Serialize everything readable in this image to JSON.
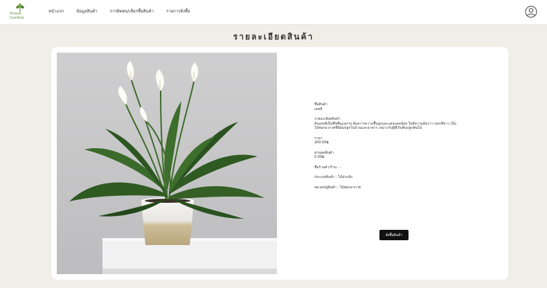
{
  "brand": {
    "line1": "Prana",
    "line2": "Garden"
  },
  "nav": {
    "items": [
      {
        "label": "หน้าแรก"
      },
      {
        "label": "ข้อมูลสินค้า"
      },
      {
        "label": "การติดต่อ/เลือกซื้อสินค้า"
      },
      {
        "label": "รายการสั่งซื้อ"
      }
    ]
  },
  "page": {
    "title": "รายละเอียดสินค้า"
  },
  "product": {
    "name_label": "ชื่อสินค้า",
    "name": "เดหลี",
    "desc_label": "รายละเอียดสินค้า",
    "desc": "ต้นเดหลีเป็นพืชที่ดูแลง่าย ต้องการความชื้นสูงและแสงแดดน้อย ใบมีความมันวาว ดอกสีขาว เป็นไม้ฟอกอากาศที่นิยมปลูกในบ้านและอาคาร เหมาะกับผู้ที่เริ่มต้นปลูกต้นไม้",
    "price_label": "ราคา",
    "price": "200.00฿",
    "discount_label": "ส่วนลดสินค้า",
    "discount": "0.00฿",
    "seller_label": "ชื่อร้านค้า/ร้าน : -",
    "type_label": "ประเภทสินค้า : ไม้ประดับ",
    "category_label": "หมวดหมู่สินค้า : ไม้ฟอกอากาศ",
    "add_button": "สั่งซื้อสินค้า"
  },
  "colors": {
    "background": "#f0efe7",
    "accent": "#111111",
    "brand_green": "#6a8a4a"
  },
  "icons": {
    "profile": "user-circle-icon",
    "logo": "plant-logo-icon"
  }
}
